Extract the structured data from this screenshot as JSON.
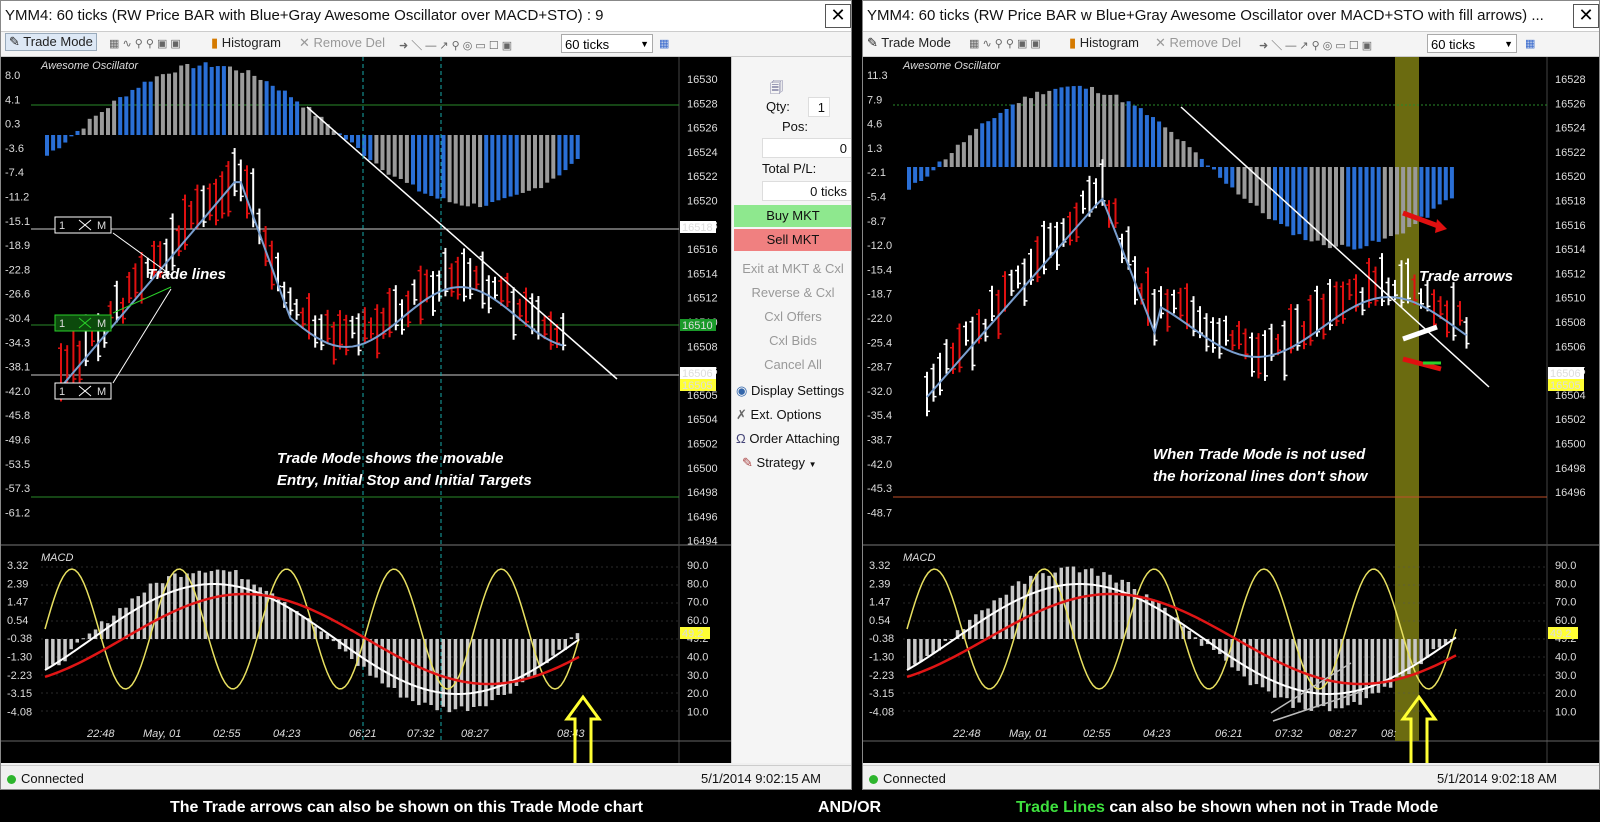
{
  "left_window": {
    "title": "YMM4: 60 ticks (RW Price BAR  with  Blue+Gray Awesome Oscillator over MACD+STO) : 9",
    "close": "✕",
    "toolbar": {
      "trade_mode": "Trade Mode",
      "histogram": "Histogram",
      "remove_del": "Remove Del",
      "ticks": "60 ticks"
    },
    "panel_label": "Awesome Oscillator",
    "macd_label": "MACD",
    "y_labels": [
      "8.0",
      "4.1",
      "0.3",
      "-3.6",
      "-7.4",
      "-11.2",
      "-15.1",
      "-18.9",
      "-22.8",
      "-26.6",
      "-30.4",
      "-34.3",
      "-38.1",
      "-42.0",
      "-45.8",
      "-49.6",
      "-53.5",
      "-57.3",
      "-61.2"
    ],
    "price_labels": [
      "16530",
      "16528",
      "16526",
      "16524",
      "16522",
      "16520",
      "16518",
      "16516",
      "16514",
      "16512",
      "16510",
      "16508",
      "16506",
      "16505",
      "16504",
      "16502",
      "16500",
      "16498",
      "16496",
      "16494"
    ],
    "macd_y_labels": [
      "3.32",
      "2.39",
      "1.47",
      "0.54",
      "-0.38",
      "-1.30",
      "-2.23",
      "-3.15",
      "-4.08"
    ],
    "sto_labels": [
      "90.0",
      "80.0",
      "70.0",
      "60.0",
      "49.2",
      "40.0",
      "30.0",
      "20.0",
      "10.0"
    ],
    "time_labels": [
      "22:48",
      "May, 01",
      "02:55",
      "04:23",
      "06:21",
      "07:32",
      "08:27",
      "08:43"
    ],
    "order_buttons": [
      "1",
      "M"
    ],
    "annotations": {
      "trade_lines": "Trade lines",
      "mode_line1": "Trade Mode shows the movable",
      "mode_line2": "Entry, Initial Stop and Initial Targets"
    },
    "status": {
      "connection": "Connected",
      "clock": "5/1/2014 9:02:15 AM"
    }
  },
  "trade_panel": {
    "qty_label": "Qty:",
    "qty_value": "1",
    "pos_label": "Pos:",
    "pos_value": "0",
    "pl_label": "Total P/L:",
    "pl_value": "0 ticks",
    "buy": "Buy MKT",
    "sell": "Sell MKT",
    "disabled": [
      "Exit at MKT & Cxl",
      "Reverse & Cxl",
      "Cxl Offers",
      "Cxl Bids",
      "Cancel All"
    ],
    "menu": [
      "Display Settings",
      "Ext. Options",
      "Order Attaching",
      "Strategy"
    ]
  },
  "right_window": {
    "title": "YMM4: 60 ticks (RW Price   BAR         w Blue+Gray Awesome Oscillator over MACD+STO with fill arrows) ...",
    "close": "✕",
    "toolbar": {
      "trade_mode": "Trade Mode",
      "histogram": "Histogram",
      "remove_del": "Remove Del",
      "ticks": "60 ticks"
    },
    "panel_label": "Awesome Oscillator",
    "macd_label": "MACD",
    "y_labels": [
      "11.3",
      "7.9",
      "4.6",
      "1.3",
      "-2.1",
      "-5.4",
      "-8.7",
      "-12.0",
      "-15.4",
      "-18.7",
      "-22.0",
      "-25.4",
      "-28.7",
      "-32.0",
      "-35.4",
      "-38.7",
      "-42.0",
      "-45.3",
      "-48.7"
    ],
    "price_labels": [
      "16528",
      "16526",
      "16524",
      "16522",
      "16520",
      "16518",
      "16516",
      "16514",
      "16512",
      "16510",
      "16508",
      "16506",
      "16505",
      "16504",
      "16502",
      "16500",
      "16498",
      "16496"
    ],
    "macd_y_labels": [
      "3.32",
      "2.39",
      "1.47",
      "0.54",
      "-0.38",
      "-1.30",
      "-2.23",
      "-3.15",
      "-4.08"
    ],
    "sto_labels": [
      "90.0",
      "80.0",
      "70.0",
      "60.0",
      "49.2",
      "40.0",
      "30.0",
      "20.0",
      "10.0"
    ],
    "time_labels": [
      "22:48",
      "May, 01",
      "02:55",
      "04:23",
      "06:21",
      "07:32",
      "08:27",
      "08:"
    ],
    "annotations": {
      "trade_arrows": "Trade arrows",
      "no_mode_line1": "When Trade Mode is not used",
      "no_mode_line2": "the horizonal lines don't show"
    },
    "status": {
      "connection": "Connected",
      "clock": "5/1/2014 9:02:18 AM"
    }
  },
  "captions": {
    "left": "The Trade arrows can also be shown on this Trade Mode chart",
    "middle": "AND/OR",
    "right_green": "Trade Lines",
    "right_rest": " can also be shown when not in Trade Mode"
  },
  "colors": {
    "up_bar": "#ffffff",
    "down_bar": "#e01010",
    "ao_blue": "#2a6fd6",
    "ao_gray": "#9a9a9a",
    "buy": "#8ee88e",
    "sell": "#f08080",
    "sma": "#7a9fd0",
    "highlight": "#6b6b10"
  }
}
